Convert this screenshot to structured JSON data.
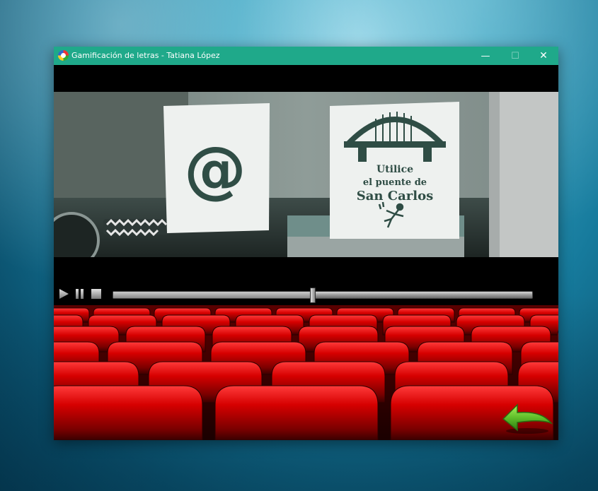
{
  "window": {
    "title": "Gamificación de letras - Tatiana López",
    "minimize_glyph": "—",
    "maximize_glyph": "☐",
    "close_glyph": "✕",
    "app_icon": "app-icon"
  },
  "video": {
    "sign_left_symbol": "@",
    "sign_right_lines": [
      "Utilice",
      "el puente de",
      "San Carlos"
    ]
  },
  "player": {
    "icons": [
      "play-icon",
      "pause-icon",
      "stop-icon"
    ],
    "progress": 0.475
  },
  "scene": {
    "background": "theater-seats",
    "seat_color": "#c00000"
  },
  "navigation": {
    "back_icon": "back-arrow-icon",
    "back_color": "#5fbf2a"
  }
}
